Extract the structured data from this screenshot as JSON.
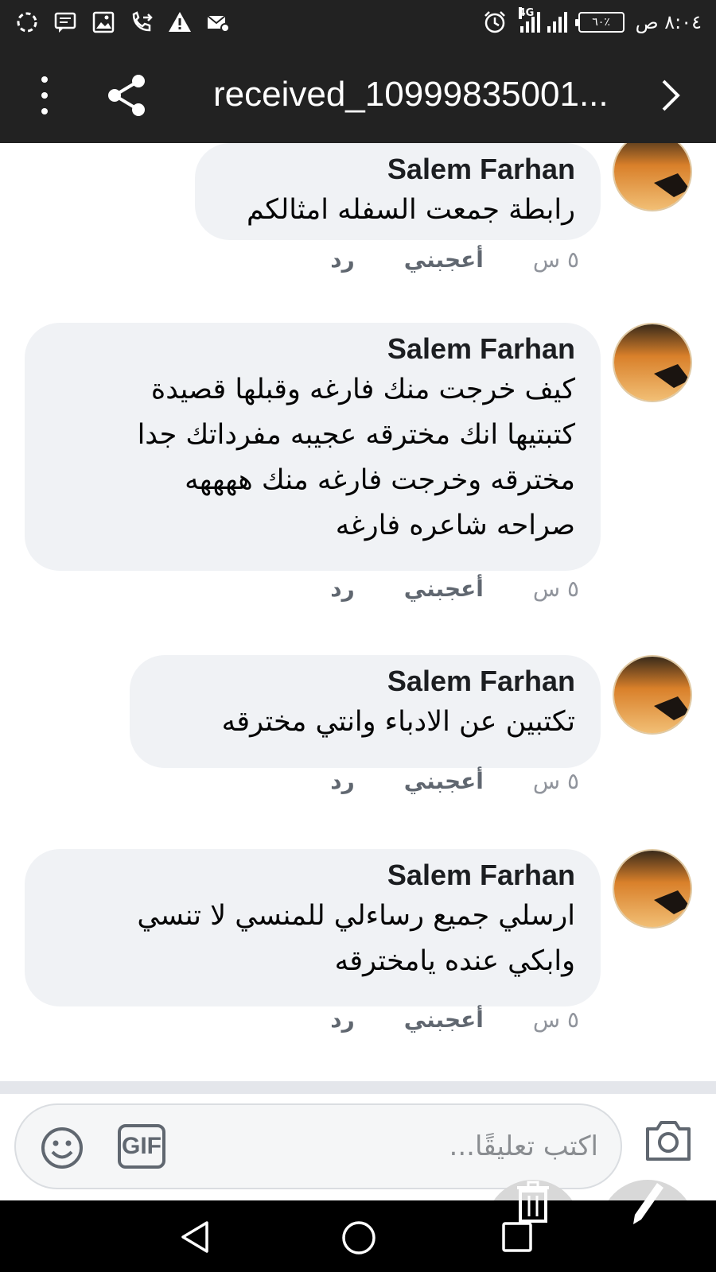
{
  "status_bar": {
    "time": "٨:٠٤ ص",
    "battery": "٦٠٪",
    "network": "4G"
  },
  "app_bar": {
    "title": "received_10999835001..."
  },
  "comments": [
    {
      "author": "Salem Farhan",
      "lines": [
        "رابطة جمعت السفله امثالكم"
      ],
      "time": "٥ س",
      "like": "أعجبني",
      "reply": "رد"
    },
    {
      "author": "Salem Farhan",
      "lines": [
        "كيف خرجت منك فارغه وقبلها قصيدة",
        "كتبتيها انك مخترقه عجيبه مفرداتك جدا",
        "مخترقه وخرجت فارغه منك ههههه",
        "صراحه شاعره فارغه"
      ],
      "time": "٥ س",
      "like": "أعجبني",
      "reply": "رد"
    },
    {
      "author": "Salem Farhan",
      "lines": [
        "تكتبين عن الادباء وانتي مخترقه"
      ],
      "time": "٥ س",
      "like": "أعجبني",
      "reply": "رد"
    },
    {
      "author": "Salem Farhan",
      "lines": [
        "ارسلي جميع رساءلي للمنسي لا تنسي",
        "وابكي عنده يامخترقه"
      ],
      "time": "٥ س",
      "like": "أعجبني",
      "reply": "رد"
    }
  ],
  "composer": {
    "placeholder": "اكتب تعليقًا...",
    "gif_label": "GIF"
  },
  "icons": {
    "menu": "more-vert-icon",
    "share": "share-icon",
    "next": "chevron-right-icon",
    "emoji": "smiley-icon",
    "camera": "camera-icon",
    "back": "nav-back-icon",
    "home": "nav-home-icon",
    "recent": "nav-recent-icon",
    "delete": "trash-icon",
    "edit": "pencil-icon"
  },
  "colors": {
    "bar_bg": "#222222",
    "bubble_bg": "#f0f2f5",
    "meta_text": "#606770"
  }
}
